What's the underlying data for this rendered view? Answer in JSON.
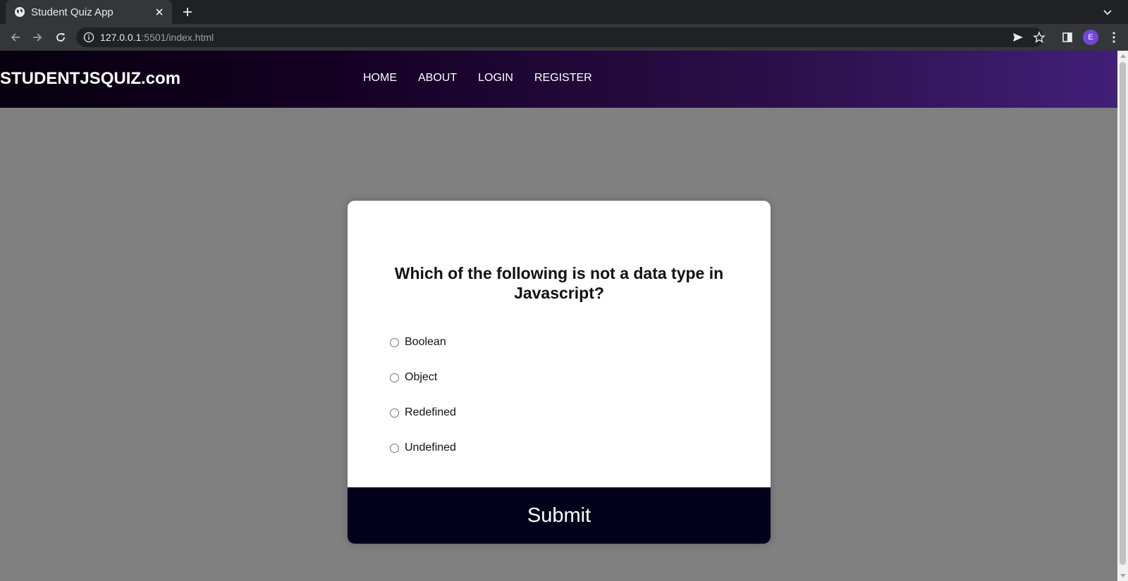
{
  "browser": {
    "tab_title": "Student Quiz App",
    "url_host": "127.0.0.1",
    "url_rest": ":5501/index.html",
    "profile_initial": "E",
    "avatar_color": "#7248d4",
    "icons": [
      "globe-favicon-icon",
      "close-icon",
      "plus-icon",
      "chevron-down-icon",
      "back-arrow-icon",
      "forward-arrow-icon",
      "reload-icon",
      "info-icon",
      "send-icon",
      "star-icon",
      "side-panel-icon",
      "kebab-menu-icon"
    ]
  },
  "header": {
    "brand": "STUDENTJSQUIZ.com",
    "nav": [
      {
        "label": "HOME"
      },
      {
        "label": "ABOUT"
      },
      {
        "label": "LOGIN"
      },
      {
        "label": "REGISTER"
      }
    ],
    "gradient_start": "#07000f",
    "gradient_end": "#421f78"
  },
  "quiz": {
    "question": "Which of the following is not a data type in Javascript?",
    "options": [
      {
        "label": "Boolean"
      },
      {
        "label": "Object"
      },
      {
        "label": "Redefined"
      },
      {
        "label": "Undefined"
      }
    ],
    "submit_label": "Submit",
    "submit_color": "#03001c"
  },
  "page": {
    "background_color": "#808080"
  }
}
